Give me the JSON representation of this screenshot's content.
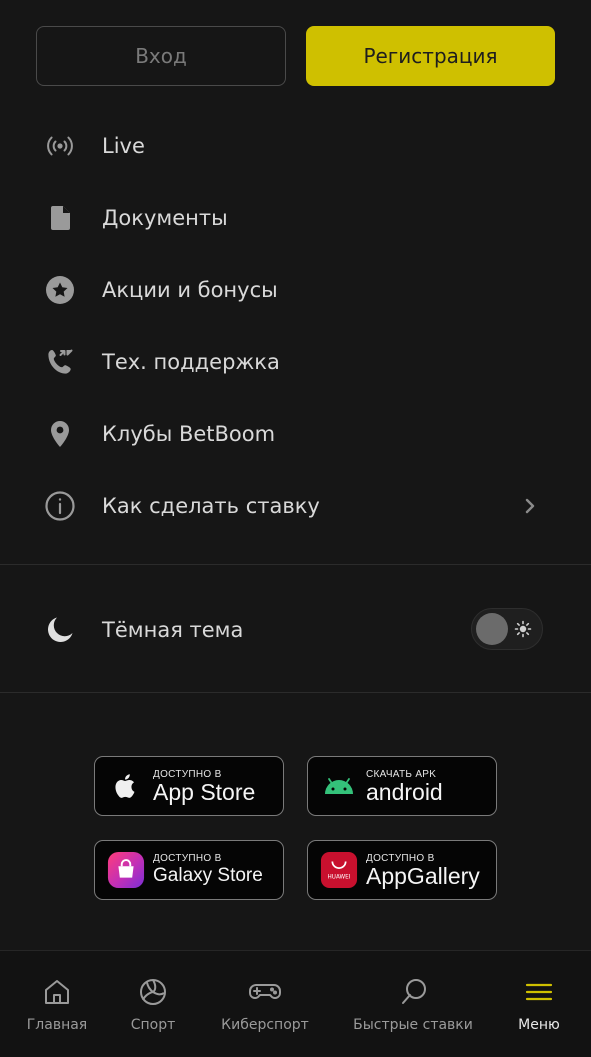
{
  "auth": {
    "login_label": "Вход",
    "register_label": "Регистрация",
    "register_color": "#cfc000"
  },
  "menu": {
    "items": [
      {
        "label": "Live",
        "icon": "live-broadcast-icon"
      },
      {
        "label": "Документы",
        "icon": "document-icon"
      },
      {
        "label": "Акции и бонусы",
        "icon": "star-badge-icon"
      },
      {
        "label": "Тех. поддержка",
        "icon": "phone-icon"
      },
      {
        "label": "Клубы BetBoom",
        "icon": "location-pin-icon"
      },
      {
        "label": "Как сделать ставку",
        "icon": "info-icon",
        "has_chevron": true
      }
    ]
  },
  "theme": {
    "label": "Тёмная тема",
    "icon": "moon-icon",
    "toggle_icon": "sun-icon"
  },
  "stores": [
    {
      "small": "ДОСТУПНО В",
      "big": "App Store",
      "icon": "apple-icon"
    },
    {
      "small": "СКАЧАТЬ APK",
      "big": "android",
      "icon": "android-icon"
    },
    {
      "small": "ДОСТУПНО В",
      "big": "Galaxy Store",
      "icon": "galaxy-store-icon"
    },
    {
      "small": "ДОСТУПНО В",
      "big": "AppGallery",
      "icon": "huawei-appgallery-icon",
      "logo_text": "HUAWEI"
    }
  ],
  "bottom_nav": [
    {
      "label": "Главная",
      "icon": "home-icon"
    },
    {
      "label": "Спорт",
      "icon": "volleyball-icon"
    },
    {
      "label": "Киберспорт",
      "icon": "gamepad-icon"
    },
    {
      "label": "Быстрые ставки",
      "icon": "ping-pong-icon"
    },
    {
      "label": "Меню",
      "icon": "hamburger-menu-icon",
      "active": true,
      "accent": "#cfc000"
    }
  ]
}
